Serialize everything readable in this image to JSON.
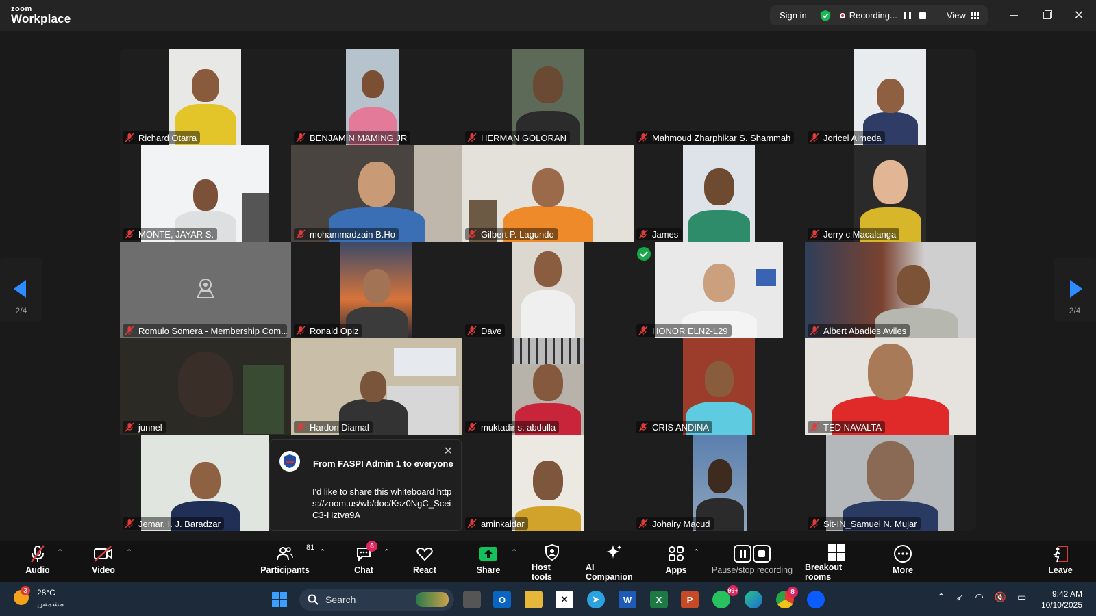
{
  "app": {
    "brand_small": "zoom",
    "brand_big": "Workplace"
  },
  "titlebar": {
    "sign_in": "Sign in",
    "recording": "Recording...",
    "view": "View"
  },
  "navigation": {
    "page_left": "2/4",
    "page_right": "2/4"
  },
  "participants": [
    {
      "name": "Richard Otarra"
    },
    {
      "name": "BENJAMIN MAMING JR"
    },
    {
      "name": "HERMAN GOLORAN"
    },
    {
      "name": "Mahmoud Zharphikar S. Shammah"
    },
    {
      "name": "Joricel Almeda"
    },
    {
      "name": "MONTE, JAYAR S."
    },
    {
      "name": "mohammadzain B.Ho"
    },
    {
      "name": "Gilbert P. Lagundo"
    },
    {
      "name": "James"
    },
    {
      "name": "Jerry c Macalanga"
    },
    {
      "name": "Romulo Somera - Membership Com..."
    },
    {
      "name": "Ronald Opiz"
    },
    {
      "name": "Dave"
    },
    {
      "name": "HONOR ELN2-L29"
    },
    {
      "name": "Albert Abadies Aviles"
    },
    {
      "name": "junnel"
    },
    {
      "name": "Hardon Diamal"
    },
    {
      "name": "muktadir s. abdulla"
    },
    {
      "name": "CRIS ANDINA"
    },
    {
      "name": "TED NAVALTA"
    },
    {
      "name": "Jemar, I. J. Baradzar"
    },
    {
      "name": "aminkaidar"
    },
    {
      "name": "Johairy Macud"
    },
    {
      "name": "Sit-IN_Samuel N. Mujar"
    }
  ],
  "chat_popup": {
    "from": "From FASPI Admin 1 to everyone",
    "message": "I'd like to share this whiteboard https://zoom.us/wb/doc/Ksz0NgC_SceiC3-Hztva9A"
  },
  "toolbar": {
    "audio": "Audio",
    "video": "Video",
    "participants": "Participants",
    "participants_count": "81",
    "chat": "Chat",
    "chat_badge": "6",
    "react": "React",
    "share": "Share",
    "host_tools": "Host tools",
    "ai_companion": "AI Companion",
    "apps": "Apps",
    "pause_stop": "Pause/stop recording",
    "breakout": "Breakout rooms",
    "more": "More",
    "leave": "Leave"
  },
  "taskbar": {
    "weather_badge": "3",
    "temperature": "28°C",
    "condition": "مشمس",
    "search": "Search",
    "whatsapp_badge": "99+",
    "chrome_badge": "8",
    "time": "9:42 AM",
    "date": "10/10/2025"
  },
  "colors": {
    "accent": "#0b5cff",
    "share_green": "#13c25a",
    "badge": "#e0245e",
    "mic_off": "#e03a3a"
  }
}
